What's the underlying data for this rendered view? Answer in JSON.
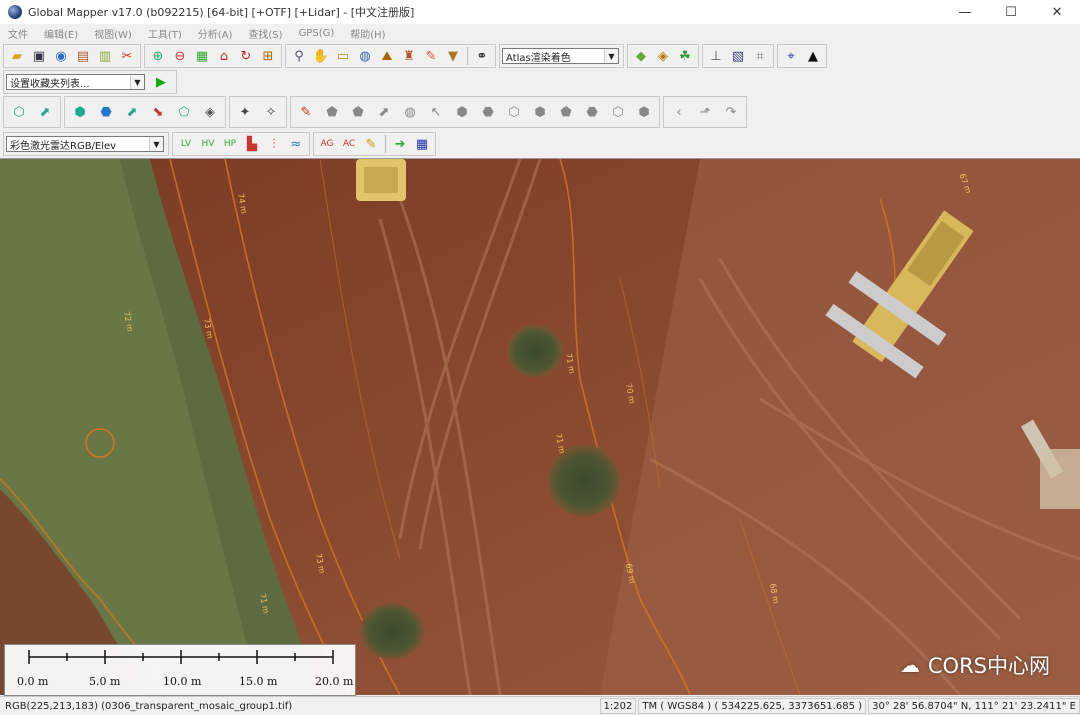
{
  "window": {
    "title": "Global Mapper v17.0 (b092215) [64-bit] [+OTF] [+Lidar] - [中文注册版]",
    "controls": [
      "—",
      "☐",
      "✕"
    ]
  },
  "menu": [
    "文件",
    "编辑(E)",
    "视图(W)",
    "工具(T)",
    "分析(A)",
    "查找(S)",
    "GPS(G)",
    "帮助(H)"
  ],
  "toolbar": {
    "shader_select": "Atlas渲染着色",
    "favorites_select": "设置收藏夹列表...",
    "lidar_color_select": "彩色激光雷达RGB/Elev"
  },
  "map": {
    "contour_labels": [
      "74 m",
      "73 m",
      "72 m",
      "71 m",
      "70 m",
      "69 m",
      "71 m",
      "73 m",
      "67 m",
      "71 m",
      "68 m"
    ]
  },
  "scalebar": {
    "labels": [
      "0.0 m",
      "5.0 m",
      "10.0 m",
      "15.0 m",
      "20.0 m"
    ]
  },
  "watermark": {
    "text": "CORS中心网"
  },
  "status": {
    "pixel_info": "RGB(225,213,183) (0306_transparent_mosaic_group1.tif)",
    "scale": "1:202",
    "projection": "TM ( WGS84 ) ( 534225.625, 3373651.685 )",
    "latlon": "30° 28' 56.8704\" N, 111° 21' 23.2411\" E"
  }
}
